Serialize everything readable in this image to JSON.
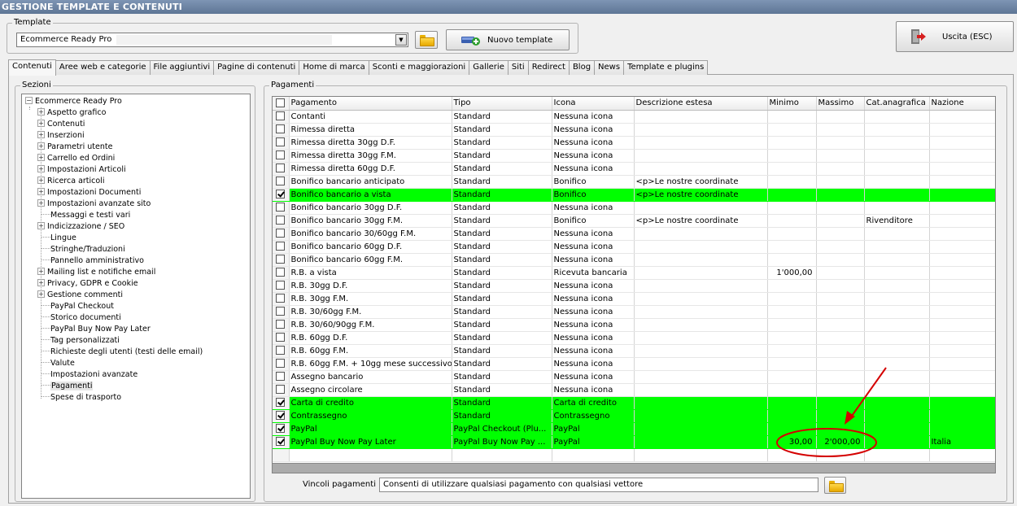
{
  "window": {
    "title": "GESTIONE TEMPLATE E CONTENUTI"
  },
  "template": {
    "group_label": "Template",
    "selected": "Ecommerce Ready Pro",
    "new_button": "Nuovo template"
  },
  "exit_button": "Uscita (ESC)",
  "tabs": [
    {
      "label": "Contenuti",
      "active": true
    },
    {
      "label": "Aree web e categorie"
    },
    {
      "label": "File aggiuntivi"
    },
    {
      "label": "Pagine di contenuti"
    },
    {
      "label": "Home di marca"
    },
    {
      "label": "Sconti e maggiorazioni"
    },
    {
      "label": "Gallerie"
    },
    {
      "label": "Siti"
    },
    {
      "label": "Redirect"
    },
    {
      "label": "Blog"
    },
    {
      "label": "News"
    },
    {
      "label": "Template e plugins"
    }
  ],
  "sections": {
    "group_label": "Sezioni",
    "root": "Ecommerce Ready Pro",
    "items": [
      {
        "label": "Aspetto grafico",
        "expandable": true
      },
      {
        "label": "Contenuti",
        "expandable": true
      },
      {
        "label": "Inserzioni",
        "expandable": true
      },
      {
        "label": "Parametri utente",
        "expandable": true
      },
      {
        "label": "Carrello ed Ordini",
        "expandable": true
      },
      {
        "label": "Impostazioni Articoli",
        "expandable": true
      },
      {
        "label": "Ricerca articoli",
        "expandable": true
      },
      {
        "label": "Impostazioni Documenti",
        "expandable": true
      },
      {
        "label": "Impostazioni avanzate sito",
        "expandable": true
      },
      {
        "label": "Messaggi e testi vari",
        "expandable": false
      },
      {
        "label": "Indicizzazione / SEO",
        "expandable": true
      },
      {
        "label": "Lingue",
        "expandable": false
      },
      {
        "label": "Stringhe/Traduzioni",
        "expandable": false
      },
      {
        "label": "Pannello amministrativo",
        "expandable": false
      },
      {
        "label": "Mailing list e notifiche email",
        "expandable": true
      },
      {
        "label": "Privacy, GDPR e Cookie",
        "expandable": true
      },
      {
        "label": "Gestione commenti",
        "expandable": true
      },
      {
        "label": "PayPal Checkout",
        "expandable": false
      },
      {
        "label": "Storico documenti",
        "expandable": false
      },
      {
        "label": "PayPal Buy Now Pay Later",
        "expandable": false
      },
      {
        "label": "Tag personalizzati",
        "expandable": false
      },
      {
        "label": "Richieste degli utenti (testi delle email)",
        "expandable": false
      },
      {
        "label": "Valute",
        "expandable": false
      },
      {
        "label": "Impostazioni avanzate",
        "expandable": false
      },
      {
        "label": "Pagamenti",
        "expandable": false,
        "selected": true
      },
      {
        "label": "Spese di trasporto",
        "expandable": false
      }
    ]
  },
  "payments": {
    "group_label": "Pagamenti",
    "columns": [
      "Pagamento",
      "Tipo",
      "Icona",
      "Descrizione estesa",
      "Minimo",
      "Massimo",
      "Cat.anagrafica",
      "Nazione"
    ],
    "rows": [
      {
        "checked": false,
        "pagamento": "Contanti",
        "tipo": "Standard",
        "icona": "Nessuna icona",
        "descrizione": "",
        "minimo": "",
        "massimo": "",
        "cat": "",
        "nazione": ""
      },
      {
        "checked": false,
        "pagamento": "Rimessa diretta",
        "tipo": "Standard",
        "icona": "Nessuna icona",
        "descrizione": "",
        "minimo": "",
        "massimo": "",
        "cat": "",
        "nazione": ""
      },
      {
        "checked": false,
        "pagamento": "Rimessa diretta 30gg D.F.",
        "tipo": "Standard",
        "icona": "Nessuna icona",
        "descrizione": "",
        "minimo": "",
        "massimo": "",
        "cat": "",
        "nazione": ""
      },
      {
        "checked": false,
        "pagamento": "Rimessa diretta 30gg F.M.",
        "tipo": "Standard",
        "icona": "Nessuna icona",
        "descrizione": "",
        "minimo": "",
        "massimo": "",
        "cat": "",
        "nazione": ""
      },
      {
        "checked": false,
        "pagamento": "Rimessa diretta 60gg D.F.",
        "tipo": "Standard",
        "icona": "Nessuna icona",
        "descrizione": "",
        "minimo": "",
        "massimo": "",
        "cat": "",
        "nazione": ""
      },
      {
        "checked": false,
        "pagamento": "Bonifico bancario anticipato",
        "tipo": "Standard",
        "icona": "Bonifico",
        "descrizione": "<p>Le nostre coordinate",
        "minimo": "",
        "massimo": "",
        "cat": "",
        "nazione": ""
      },
      {
        "checked": true,
        "pagamento": "Bonifico bancario a vista",
        "tipo": "Standard",
        "icona": "Bonifico",
        "descrizione": "<p>Le nostre coordinate",
        "minimo": "",
        "massimo": "",
        "cat": "",
        "nazione": ""
      },
      {
        "checked": false,
        "pagamento": "Bonifico bancario 30gg D.F.",
        "tipo": "Standard",
        "icona": "Nessuna icona",
        "descrizione": "",
        "minimo": "",
        "massimo": "",
        "cat": "",
        "nazione": ""
      },
      {
        "checked": false,
        "pagamento": "Bonifico bancario 30gg F.M.",
        "tipo": "Standard",
        "icona": "Bonifico",
        "descrizione": "<p>Le nostre coordinate",
        "minimo": "",
        "massimo": "",
        "cat": "Rivenditore",
        "nazione": ""
      },
      {
        "checked": false,
        "pagamento": "Bonifico bancario 30/60gg F.M.",
        "tipo": "Standard",
        "icona": "Nessuna icona",
        "descrizione": "",
        "minimo": "",
        "massimo": "",
        "cat": "",
        "nazione": ""
      },
      {
        "checked": false,
        "pagamento": "Bonifico bancario 60gg D.F.",
        "tipo": "Standard",
        "icona": "Nessuna icona",
        "descrizione": "",
        "minimo": "",
        "massimo": "",
        "cat": "",
        "nazione": ""
      },
      {
        "checked": false,
        "pagamento": "Bonifico bancario 60gg F.M.",
        "tipo": "Standard",
        "icona": "Nessuna icona",
        "descrizione": "",
        "minimo": "",
        "massimo": "",
        "cat": "",
        "nazione": ""
      },
      {
        "checked": false,
        "pagamento": "R.B. a vista",
        "tipo": "Standard",
        "icona": "Ricevuta bancaria",
        "descrizione": "",
        "minimo": "1'000,00",
        "massimo": "",
        "cat": "",
        "nazione": ""
      },
      {
        "checked": false,
        "pagamento": "R.B. 30gg D.F.",
        "tipo": "Standard",
        "icona": "Nessuna icona",
        "descrizione": "",
        "minimo": "",
        "massimo": "",
        "cat": "",
        "nazione": ""
      },
      {
        "checked": false,
        "pagamento": "R.B. 30gg F.M.",
        "tipo": "Standard",
        "icona": "Nessuna icona",
        "descrizione": "",
        "minimo": "",
        "massimo": "",
        "cat": "",
        "nazione": ""
      },
      {
        "checked": false,
        "pagamento": "R.B. 30/60gg F.M.",
        "tipo": "Standard",
        "icona": "Nessuna icona",
        "descrizione": "",
        "minimo": "",
        "massimo": "",
        "cat": "",
        "nazione": ""
      },
      {
        "checked": false,
        "pagamento": "R.B. 30/60/90gg F.M.",
        "tipo": "Standard",
        "icona": "Nessuna icona",
        "descrizione": "",
        "minimo": "",
        "massimo": "",
        "cat": "",
        "nazione": ""
      },
      {
        "checked": false,
        "pagamento": "R.B. 60gg D.F.",
        "tipo": "Standard",
        "icona": "Nessuna icona",
        "descrizione": "",
        "minimo": "",
        "massimo": "",
        "cat": "",
        "nazione": ""
      },
      {
        "checked": false,
        "pagamento": "R.B. 60gg F.M.",
        "tipo": "Standard",
        "icona": "Nessuna icona",
        "descrizione": "",
        "minimo": "",
        "massimo": "",
        "cat": "",
        "nazione": ""
      },
      {
        "checked": false,
        "pagamento": "R.B. 60gg F.M. + 10gg mese successivo",
        "tipo": "Standard",
        "icona": "Nessuna icona",
        "descrizione": "",
        "minimo": "",
        "massimo": "",
        "cat": "",
        "nazione": ""
      },
      {
        "checked": false,
        "pagamento": "Assegno bancario",
        "tipo": "Standard",
        "icona": "Nessuna icona",
        "descrizione": "",
        "minimo": "",
        "massimo": "",
        "cat": "",
        "nazione": ""
      },
      {
        "checked": false,
        "pagamento": "Assegno circolare",
        "tipo": "Standard",
        "icona": "Nessuna icona",
        "descrizione": "",
        "minimo": "",
        "massimo": "",
        "cat": "",
        "nazione": ""
      },
      {
        "checked": true,
        "pagamento": "Carta di credito",
        "tipo": "Standard",
        "icona": "Carta di credito",
        "descrizione": "",
        "minimo": "",
        "massimo": "",
        "cat": "",
        "nazione": ""
      },
      {
        "checked": true,
        "pagamento": "Contrassegno",
        "tipo": "Standard",
        "icona": "Contrassegno",
        "descrizione": "",
        "minimo": "",
        "massimo": "",
        "cat": "",
        "nazione": ""
      },
      {
        "checked": true,
        "pagamento": "PayPal",
        "tipo": "PayPal Checkout (Plu...",
        "icona": "PayPal",
        "descrizione": "",
        "minimo": "",
        "massimo": "",
        "cat": "",
        "nazione": ""
      },
      {
        "checked": true,
        "pagamento": "PayPal Buy Now Pay Later",
        "tipo": "PayPal Buy Now Pay ...",
        "icona": "PayPal",
        "descrizione": "",
        "minimo": "30,00",
        "massimo": "2'000,00",
        "cat": "",
        "nazione": "Italia"
      }
    ]
  },
  "vincoli": {
    "label": "Vincoli pagamenti :",
    "value": "Consenti di utilizzare qualsiasi pagamento con qualsiasi vettore"
  },
  "colors": {
    "selected_row": "#00ff00",
    "annotation": "#d40000",
    "titlebar": "#6a82a3"
  }
}
